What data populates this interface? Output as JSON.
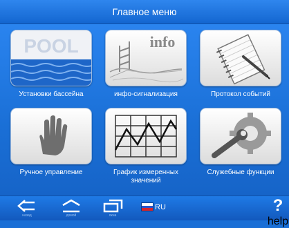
{
  "header": {
    "title": "Главное меню"
  },
  "tiles": [
    {
      "label": "Установки бассейна",
      "image_text": "POOL"
    },
    {
      "label": "инфо-сигнализация",
      "image_text": "info"
    },
    {
      "label": "Протокол событий"
    },
    {
      "label": "Ручное управление"
    },
    {
      "label": "График измеренных значений"
    },
    {
      "label": "Служебные функции"
    }
  ],
  "bottombar": {
    "back_caption": "назад",
    "home_caption": "домой",
    "windows_caption": "окна",
    "language_code": "RU",
    "help_symbol": "?",
    "help_caption": "help"
  },
  "colors": {
    "background": "#1a6fd6",
    "tile": "#ffffff",
    "accent": "#1e73e0"
  }
}
